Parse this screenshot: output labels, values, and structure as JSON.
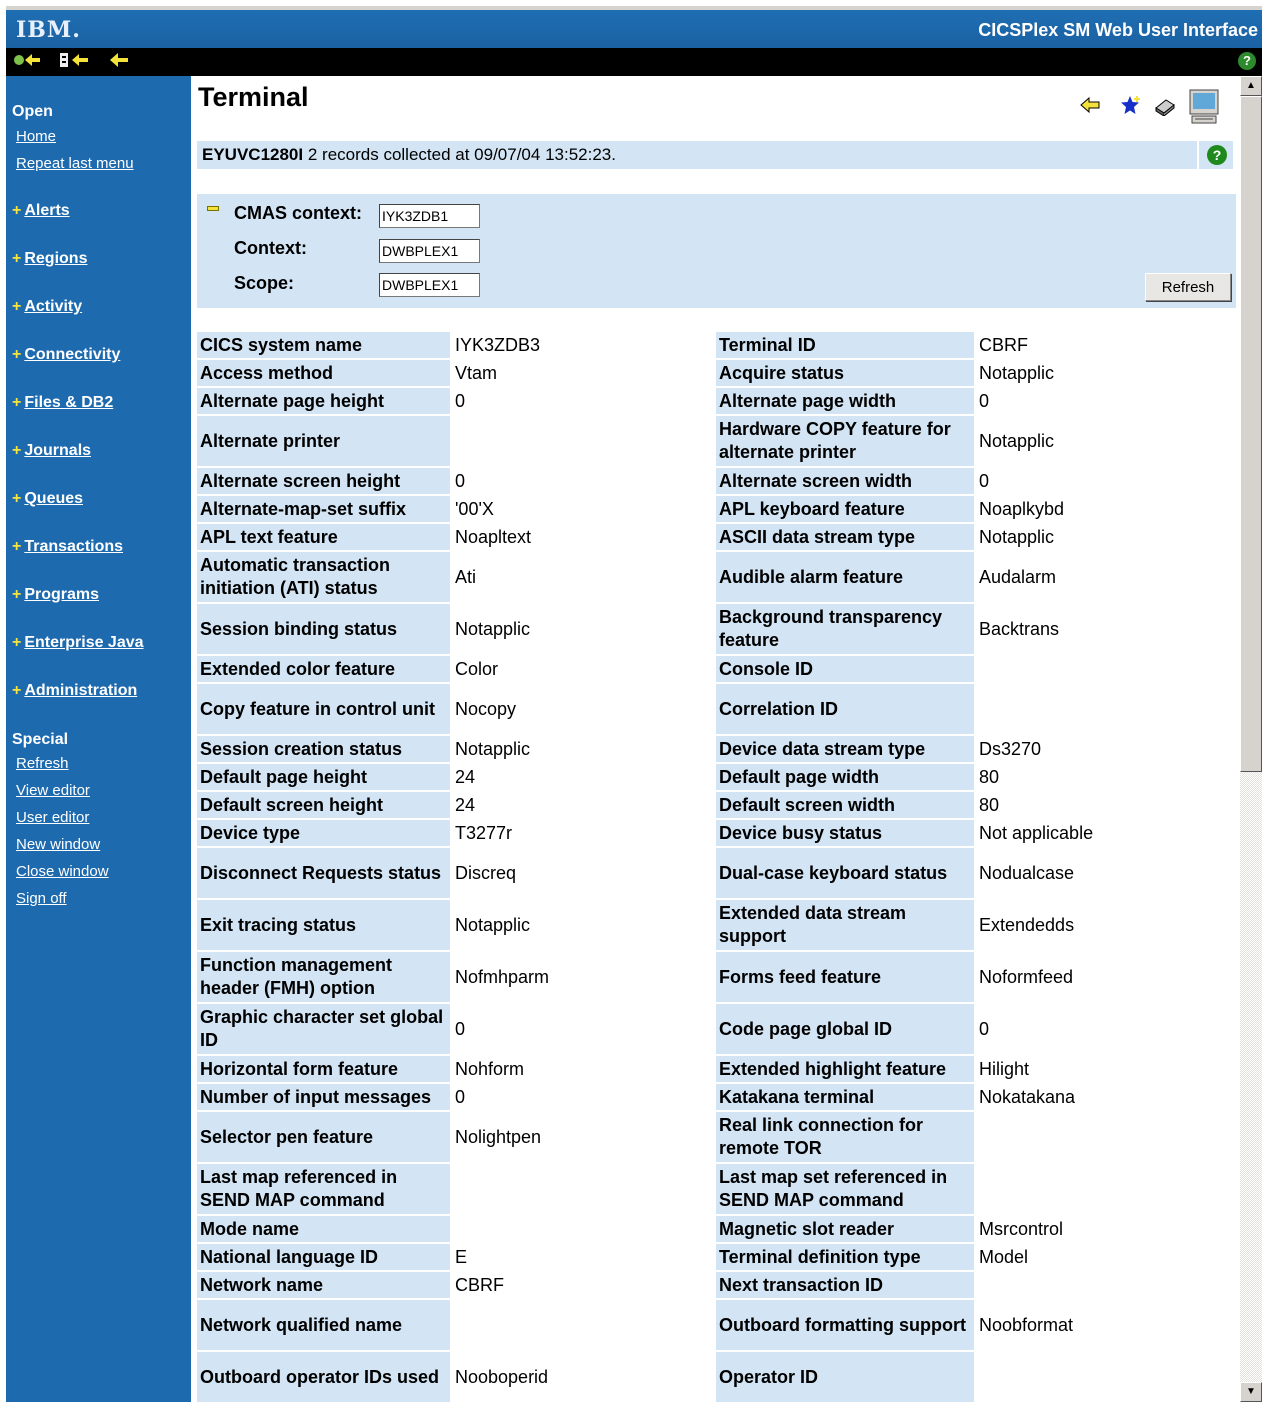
{
  "header": {
    "logo": "IBM.",
    "app_title": "CICSPlex SM Web User Interface"
  },
  "toolbar": {
    "icons": [
      "back-home-icon",
      "back-menu-icon",
      "back-icon",
      "help-icon"
    ],
    "help_glyph": "?"
  },
  "sidebar": {
    "open_heading": "Open",
    "open_links": [
      "Home",
      "Repeat last menu"
    ],
    "categories": [
      "Alerts",
      "Regions",
      "Activity",
      "Connectivity",
      "Files & DB2",
      "Journals",
      "Queues",
      "Transactions",
      "Programs",
      "Enterprise Java",
      "Administration"
    ],
    "special_heading": "Special",
    "special_links": [
      "Refresh",
      "View editor",
      "User editor",
      "New window",
      "Close window",
      "Sign off"
    ]
  },
  "main": {
    "title": "Terminal",
    "message_id": "EYUVC1280I",
    "message_text": "2 records collected at 09/07/04 13:52:23.",
    "context": {
      "cmas_label": "CMAS context:",
      "cmas_value": "IYK3ZDB1",
      "context_label": "Context:",
      "context_value": "DWBPLEX1",
      "scope_label": "Scope:",
      "scope_value": "DWBPLEX1",
      "refresh_label": "Refresh"
    },
    "rows": [
      {
        "l1": "CICS system name",
        "v1": "IYK3ZDB3",
        "l2": "Terminal ID",
        "v2": "CBRF"
      },
      {
        "l1": "Access method",
        "v1": "Vtam",
        "l2": "Acquire status",
        "v2": "Notapplic"
      },
      {
        "l1": "Alternate page height",
        "v1": "0",
        "l2": "Alternate page width",
        "v2": "0"
      },
      {
        "l1": "Alternate printer",
        "v1": "",
        "l2": "Hardware COPY feature for alternate printer",
        "v2": "Notapplic"
      },
      {
        "l1": "Alternate screen height",
        "v1": "0",
        "l2": "Alternate screen width",
        "v2": "0"
      },
      {
        "l1": "Alternate-map-set suffix",
        "v1": "'00'X",
        "l2": "APL keyboard feature",
        "v2": "Noaplkybd"
      },
      {
        "l1": "APL text feature",
        "v1": "Noapltext",
        "l2": "ASCII data stream type",
        "v2": "Notapplic"
      },
      {
        "l1": "Automatic transaction initiation (ATI) status",
        "v1": "Ati",
        "l2": "Audible alarm feature",
        "v2": "Audalarm"
      },
      {
        "l1": "Session binding status",
        "v1": "Notapplic",
        "l2": "Background transparency feature",
        "v2": "Backtrans"
      },
      {
        "l1": "Extended color feature",
        "v1": "Color",
        "l2": "Console ID",
        "v2": ""
      },
      {
        "l1": "Copy feature in control unit",
        "v1": "Nocopy",
        "l2": "Correlation ID",
        "v2": ""
      },
      {
        "l1": "Session creation status",
        "v1": "Notapplic",
        "l2": "Device data stream type",
        "v2": "Ds3270"
      },
      {
        "l1": "Default page height",
        "v1": "24",
        "l2": "Default page width",
        "v2": "80"
      },
      {
        "l1": "Default screen height",
        "v1": "24",
        "l2": "Default screen width",
        "v2": "80"
      },
      {
        "l1": "Device type",
        "v1": "T3277r",
        "l2": "Device busy status",
        "v2": "Not applicable"
      },
      {
        "l1": "Disconnect Requests status",
        "v1": "Discreq",
        "l2": "Dual-case keyboard status",
        "v2": "Nodualcase"
      },
      {
        "l1": "Exit tracing status",
        "v1": "Notapplic",
        "l2": "Extended data stream support",
        "v2": "Extendedds"
      },
      {
        "l1": "Function management header (FMH) option",
        "v1": "Nofmhparm",
        "l2": "Forms feed feature",
        "v2": "Noformfeed"
      },
      {
        "l1": "Graphic character set global ID",
        "v1": "0",
        "l2": "Code page global ID",
        "v2": "0"
      },
      {
        "l1": "Horizontal form feature",
        "v1": "Nohform",
        "l2": "Extended highlight feature",
        "v2": "Hilight"
      },
      {
        "l1": "Number of input messages",
        "v1": "0",
        "l2": "Katakana terminal",
        "v2": "Nokatakana"
      },
      {
        "l1": "Selector pen feature",
        "v1": "Nolightpen",
        "l2": "Real link connection for remote TOR",
        "v2": ""
      },
      {
        "l1": "Last map referenced in SEND MAP command",
        "v1": "",
        "l2": "Last map set referenced in SEND MAP command",
        "v2": ""
      },
      {
        "l1": "Mode name",
        "v1": "",
        "l2": "Magnetic slot reader",
        "v2": "Msrcontrol"
      },
      {
        "l1": "National language ID",
        "v1": "E",
        "l2": "Terminal definition type",
        "v2": "Model"
      },
      {
        "l1": "Network name",
        "v1": "CBRF",
        "l2": "Next transaction ID",
        "v2": ""
      },
      {
        "l1": "Network qualified name",
        "v1": "",
        "l2": "Outboard formatting support",
        "v2": "Noobformat"
      },
      {
        "l1": "Outboard operator IDs used",
        "v1": "Nooboperid",
        "l2": "Operator ID",
        "v2": ""
      }
    ]
  },
  "colors": {
    "sidebar": "#1d6aaf",
    "label_cell": "#d3e5f5",
    "plus": "#f5e23a"
  }
}
